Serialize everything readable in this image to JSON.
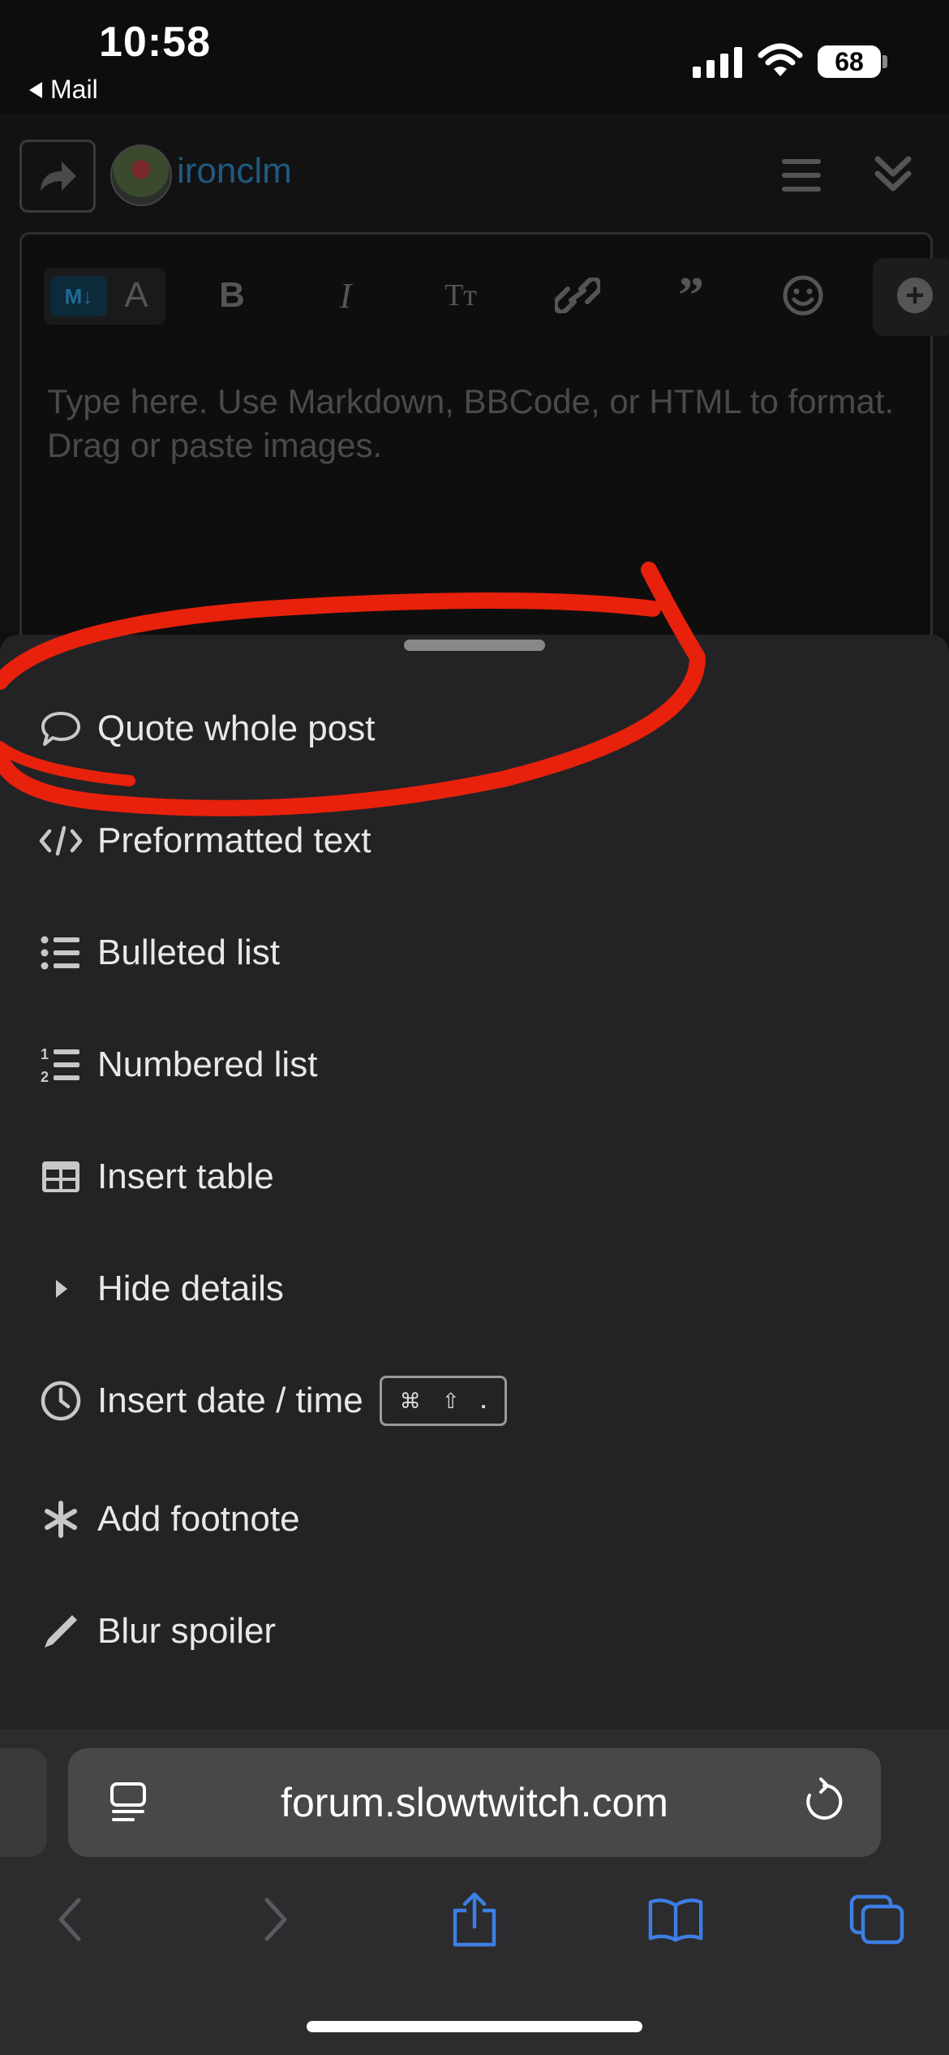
{
  "status_bar": {
    "time": "10:58",
    "back_label": "Mail",
    "battery": "68"
  },
  "editor": {
    "username": "ironclm",
    "md_badge": "M↓",
    "placeholder": "Type here. Use Markdown, BBCode, or HTML to format. Drag or paste images.",
    "toolbar_icons": [
      "markdown-toggle-icon",
      "font-a-icon",
      "bold-icon",
      "italic-icon",
      "text-size-icon",
      "link-icon",
      "blockquote-icon",
      "emoji-icon",
      "plus-icon"
    ]
  },
  "menu": {
    "items": [
      {
        "label": "Quote whole post",
        "icon": "speech-bubble-icon"
      },
      {
        "label": "Preformatted text",
        "icon": "code-icon"
      },
      {
        "label": "Bulleted list",
        "icon": "bulleted-list-icon"
      },
      {
        "label": "Numbered list",
        "icon": "numbered-list-icon"
      },
      {
        "label": "Insert table",
        "icon": "table-icon"
      },
      {
        "label": "Hide details",
        "icon": "caret-right-icon"
      },
      {
        "label": "Insert date / time",
        "icon": "clock-icon",
        "shortcut": [
          "⌘",
          "⇧",
          "."
        ]
      },
      {
        "label": "Add footnote",
        "icon": "asterisk-icon"
      },
      {
        "label": "Blur spoiler",
        "icon": "pencil-icon"
      }
    ]
  },
  "safari": {
    "url": "forum.slowtwitch.com",
    "accent": "#3d7ee6"
  },
  "annotation": {
    "color": "#e8210c"
  }
}
